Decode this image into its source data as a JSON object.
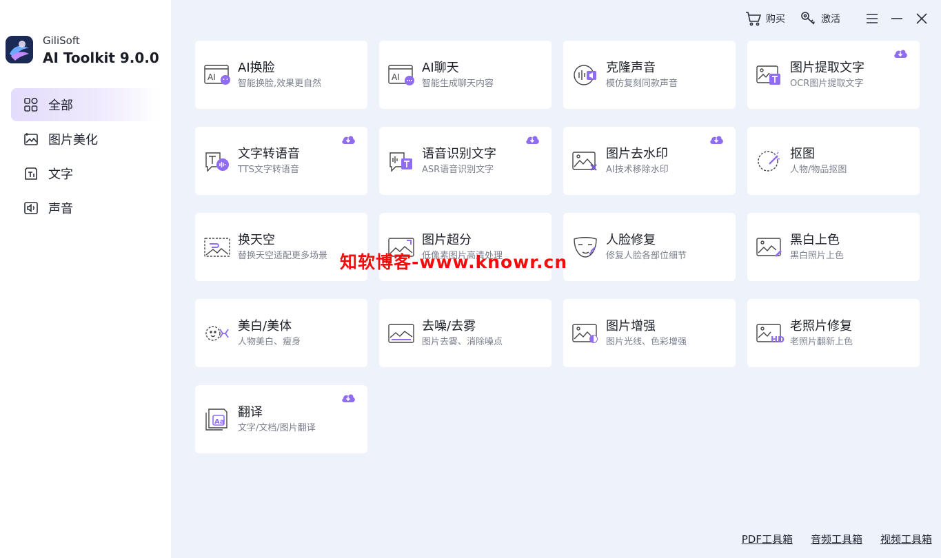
{
  "app": {
    "brand": "GiliSoft",
    "product": "AI Toolkit 9.0.0"
  },
  "colors": {
    "accent": "#8f6cf0",
    "sidebar_active": "#e7e0fb",
    "background": "#eef2fb",
    "watermark": "#f20d0d"
  },
  "topbar": {
    "buy_label": "购买",
    "buy_icon": "cart-icon",
    "activate_label": "激活",
    "activate_icon": "key-icon"
  },
  "sidebar": {
    "items": [
      {
        "label": "全部",
        "icon": "grid-icon",
        "active": true
      },
      {
        "label": "图片美化",
        "icon": "image-sparkle-icon",
        "active": false
      },
      {
        "label": "文字",
        "icon": "text-icon",
        "active": false
      },
      {
        "label": "声音",
        "icon": "speaker-icon",
        "active": false
      }
    ]
  },
  "tools": [
    {
      "title": "AI换脸",
      "subtitle": "智能换脸,效果更自然",
      "icon": "face-swap-icon",
      "download": false
    },
    {
      "title": "AI聊天",
      "subtitle": "智能生成聊天内容",
      "icon": "ai-chat-icon",
      "download": false
    },
    {
      "title": "克隆声音",
      "subtitle": "模仿复刻同款声音",
      "icon": "voice-clone-icon",
      "download": false
    },
    {
      "title": "图片提取文字",
      "subtitle": "OCR图片提取文字",
      "icon": "ocr-icon",
      "download": true
    },
    {
      "title": "文字转语音",
      "subtitle": "TTS文字转语音",
      "icon": "tts-icon",
      "download": true
    },
    {
      "title": "语音识别文字",
      "subtitle": "ASR语音识别文字",
      "icon": "asr-icon",
      "download": true
    },
    {
      "title": "图片去水印",
      "subtitle": "AI技术移除水印",
      "icon": "remove-watermark-icon",
      "download": true
    },
    {
      "title": "抠图",
      "subtitle": "人物/物品抠图",
      "icon": "cutout-icon",
      "download": false
    },
    {
      "title": "换天空",
      "subtitle": "替换天空适配更多场景",
      "icon": "sky-replace-icon",
      "download": false
    },
    {
      "title": "图片超分",
      "subtitle": "低像素图片高清处理",
      "icon": "super-resolution-icon",
      "download": false
    },
    {
      "title": "人脸修复",
      "subtitle": "修复人脸各部位细节",
      "icon": "face-restore-icon",
      "download": false
    },
    {
      "title": "黑白上色",
      "subtitle": "黑白照片上色",
      "icon": "colorize-icon",
      "download": false
    },
    {
      "title": "美白/美体",
      "subtitle": "人物美白、瘦身",
      "icon": "beauty-icon",
      "download": false
    },
    {
      "title": "去噪/去雾",
      "subtitle": "图片去雾、消除噪点",
      "icon": "denoise-icon",
      "download": false
    },
    {
      "title": "图片增强",
      "subtitle": "图片光线、色彩增强",
      "icon": "enhance-icon",
      "download": false
    },
    {
      "title": "老照片修复",
      "subtitle": "老照片翻新上色",
      "icon": "old-photo-icon",
      "download": false
    },
    {
      "title": "翻译",
      "subtitle": "文字/文档/图片翻译",
      "icon": "translate-icon",
      "download": true
    }
  ],
  "watermark": "知软博客-www.knowr.cn",
  "footer": {
    "links": [
      "PDF工具箱",
      "音频工具箱",
      "视频工具箱"
    ]
  }
}
